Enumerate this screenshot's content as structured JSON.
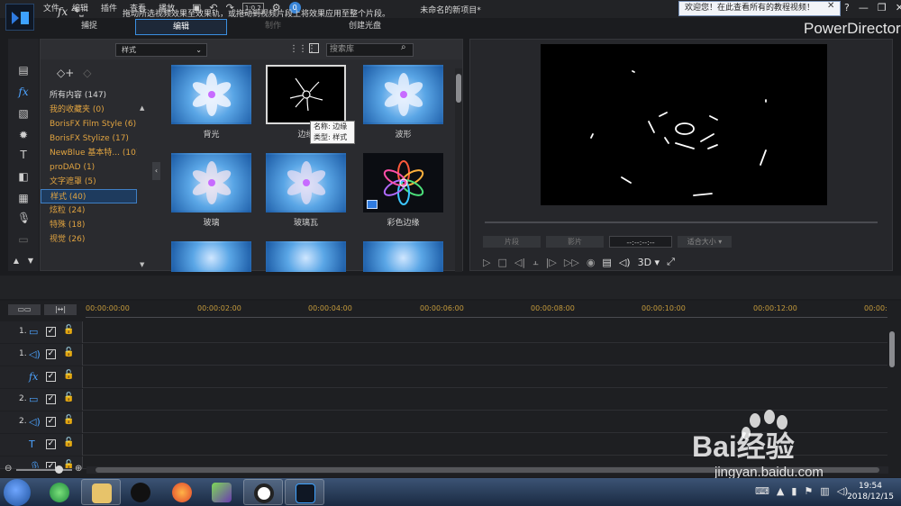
{
  "menu": [
    "文件",
    "编辑",
    "插件",
    "查看",
    "播放"
  ],
  "quick_access": {
    "undo": "↶",
    "redo": "↷",
    "resolution": "1:0.2",
    "settings": "⚙",
    "badge": "0"
  },
  "document_title": "未命名的新项目*",
  "welcome_banner": "欢迎您！在此查看所有的教程视频！",
  "window_controls": [
    "?",
    "—",
    "❐",
    "✕"
  ],
  "brand": "PowerDirector",
  "tabs": [
    {
      "label": "捕捉",
      "state": "normal"
    },
    {
      "label": "编辑",
      "state": "active"
    },
    {
      "label": "制作",
      "state": "dim"
    },
    {
      "label": "创建光盘",
      "state": "normal"
    }
  ],
  "room_icons": [
    "media-room-icon",
    "fx-room-icon",
    "pip-room-icon",
    "particle-room-icon",
    "title-room-icon",
    "transition-room-icon",
    "audio-mixing-icon",
    "voiceover-icon",
    "chapter-icon"
  ],
  "library": {
    "dropdown": "样式",
    "search_placeholder": "搜索库",
    "categories": [
      {
        "label": "所有内容 (147)",
        "kind": "all"
      },
      {
        "label": "我的收藏夹  (0)",
        "kind": "normal"
      },
      {
        "label": "BorisFX Film Style  (6)",
        "kind": "normal"
      },
      {
        "label": "BorisFX Stylize  (17)",
        "kind": "normal"
      },
      {
        "label": "NewBlue 基本特...  (10)",
        "kind": "normal"
      },
      {
        "label": "proDAD  (1)",
        "kind": "normal"
      },
      {
        "label": "文字遮罩  (5)",
        "kind": "normal"
      },
      {
        "label": "样式  (40)",
        "kind": "selected"
      },
      {
        "label": "炫粒  (24)",
        "kind": "normal"
      },
      {
        "label": "特殊  (18)",
        "kind": "normal"
      },
      {
        "label": "视觉  (26)",
        "kind": "normal"
      }
    ],
    "effects": [
      {
        "label": "背光",
        "thumb": "blue-flower"
      },
      {
        "label": "边缘",
        "thumb": "edge-lines",
        "selected": true
      },
      {
        "label": "波形",
        "thumb": "blue-flower"
      },
      {
        "label": "玻璃",
        "thumb": "blue-flower"
      },
      {
        "label": "玻璃瓦",
        "thumb": "blue-flower"
      },
      {
        "label": "彩色边缘",
        "thumb": "color-edge"
      },
      {
        "label": "",
        "thumb": "blue-flower"
      },
      {
        "label": "",
        "thumb": "blue-flower"
      },
      {
        "label": "",
        "thumb": "blue-flower"
      }
    ],
    "tooltip": {
      "name": "名称: 边缘",
      "type": "类型: 样式"
    }
  },
  "preview": {
    "clip_btn": "片段",
    "movie_btn": "影片",
    "timecode": "--:--:--:--",
    "fit": "适合大小",
    "dimension": "3D"
  },
  "fx_hint": "拖动所选视频效果至效果轨，或拖动到视频片段上将效果应用至整个片段。",
  "timeline": {
    "ruler": [
      "00:00:00:00",
      "00:00:02:00",
      "00:00:04:00",
      "00:00:06:00",
      "00:00:08:00",
      "00:00:10:00",
      "00:00:12:00",
      "00:00:"
    ],
    "tracks": [
      {
        "num": "1.",
        "icon": "video-track-icon",
        "glyph": "▭"
      },
      {
        "num": "1.",
        "icon": "audio-track-icon",
        "glyph": "◁)"
      },
      {
        "num": "",
        "icon": "fx-track-icon",
        "glyph": "fx"
      },
      {
        "num": "2.",
        "icon": "video-track-icon",
        "glyph": "▭"
      },
      {
        "num": "2.",
        "icon": "audio-track-icon",
        "glyph": "◁)"
      },
      {
        "num": "",
        "icon": "title-track-icon",
        "glyph": "T"
      },
      {
        "num": "",
        "icon": "voice-track-icon",
        "glyph": "🎙"
      }
    ]
  },
  "clock": {
    "time": "19:54",
    "date": "2018/12/15"
  },
  "watermark": {
    "text": "Bai经验",
    "sub": "jingyan.baidu.com"
  }
}
